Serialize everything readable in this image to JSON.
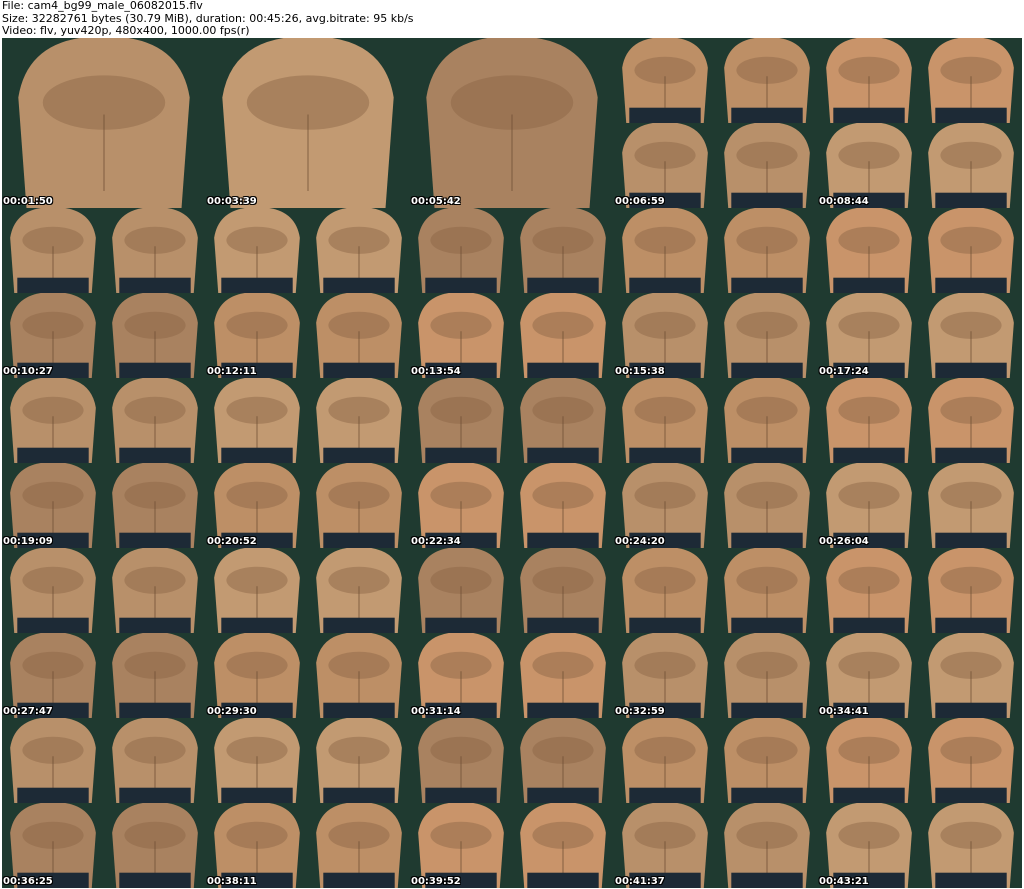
{
  "header": {
    "line1": "File: cam4_bg99_male_06082015.flv",
    "line2": "Size: 32282761 bytes (30.79 MiB), duration: 00:45:26, avg.bitrate: 95 kb/s",
    "line3": "Video: flv, yuv420p, 480x400, 1000.00 fps(r)"
  },
  "thumbnails": [
    {
      "timestamp": "00:01:50",
      "layout": "single"
    },
    {
      "timestamp": "00:03:39",
      "layout": "single"
    },
    {
      "timestamp": "00:05:42",
      "layout": "single"
    },
    {
      "timestamp": "00:06:59",
      "layout": "quad"
    },
    {
      "timestamp": "00:08:44",
      "layout": "quad"
    },
    {
      "timestamp": "00:10:27",
      "layout": "quad"
    },
    {
      "timestamp": "00:12:11",
      "layout": "quad"
    },
    {
      "timestamp": "00:13:54",
      "layout": "quad"
    },
    {
      "timestamp": "00:15:38",
      "layout": "quad"
    },
    {
      "timestamp": "00:17:24",
      "layout": "quad"
    },
    {
      "timestamp": "00:19:09",
      "layout": "quad"
    },
    {
      "timestamp": "00:20:52",
      "layout": "quad"
    },
    {
      "timestamp": "00:22:34",
      "layout": "quad"
    },
    {
      "timestamp": "00:24:20",
      "layout": "quad"
    },
    {
      "timestamp": "00:26:04",
      "layout": "quad"
    },
    {
      "timestamp": "00:27:47",
      "layout": "quad"
    },
    {
      "timestamp": "00:29:30",
      "layout": "quad"
    },
    {
      "timestamp": "00:31:14",
      "layout": "quad"
    },
    {
      "timestamp": "00:32:59",
      "layout": "quad"
    },
    {
      "timestamp": "00:34:41",
      "layout": "quad"
    },
    {
      "timestamp": "00:36:25",
      "layout": "quad"
    },
    {
      "timestamp": "00:38:11",
      "layout": "quad"
    },
    {
      "timestamp": "00:39:52",
      "layout": "quad"
    },
    {
      "timestamp": "00:41:37",
      "layout": "quad"
    },
    {
      "timestamp": "00:43:21",
      "layout": "quad"
    }
  ],
  "colors": {
    "background": "#1f3a30",
    "skin": "#b08660",
    "shorts": "#1d2a36"
  }
}
